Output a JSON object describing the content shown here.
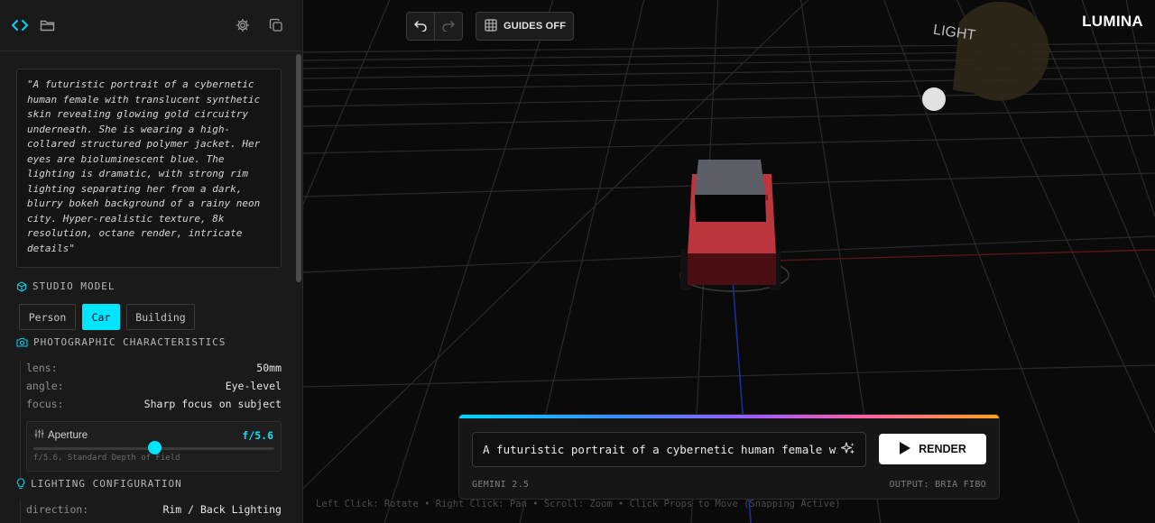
{
  "sidebar": {
    "prompt_text": "\"A futuristic portrait of a cybernetic human female with translucent synthetic skin revealing glowing gold circuitry underneath. She is wearing a high-collared structured polymer jacket. Her eyes are bioluminescent blue. The lighting is dramatic, with strong rim lighting separating her from a dark, blurry bokeh background of a rainy neon city. Hyper-realistic texture, 8k resolution, octane render, intricate details\"",
    "studio_model": {
      "title": "STUDIO MODEL",
      "options": [
        "Person",
        "Car",
        "Building"
      ],
      "selected": "Car"
    },
    "photographic": {
      "title": "PHOTOGRAPHIC CHARACTERISTICS",
      "rows": [
        {
          "key": "lens:",
          "value": "50mm"
        },
        {
          "key": "angle:",
          "value": "Eye-level"
        },
        {
          "key": "focus:",
          "value": "Sharp focus on subject"
        }
      ],
      "aperture": {
        "label": "Aperture",
        "value": "f/5.6",
        "description": "f/5.6, Standard Depth of Field",
        "level": 0.5
      }
    },
    "lighting": {
      "title": "LIGHTING CONFIGURATION",
      "rows": [
        {
          "key": "direction:",
          "value": "Rim / Back Lighting"
        }
      ]
    }
  },
  "toolbar": {
    "guides_label": "GUIDES OFF"
  },
  "brand": "LUMINA",
  "scene": {
    "light_label": "LIGHT",
    "hint": "Left Click: Rotate • Right Click: Pan • Scroll: Zoom • Click Props to Move (Snapping Active)"
  },
  "render_bar": {
    "prompt_value": "A futuristic portrait of a cybernetic human female with translucent synthetic skin",
    "render_label": "RENDER",
    "model_label": "GEMINI 2.5",
    "output_label": "OUTPUT: BRIA FIBO"
  },
  "colors": {
    "accent": "#00e5ff",
    "car_body": "#b8343a",
    "car_roof": "#5c5e66",
    "light_cone": "#3a3018"
  },
  "icons": {
    "code": "code-icon",
    "folder": "folder-icon",
    "settings": "gear-icon",
    "copy": "copy-icon",
    "undo": "undo-icon",
    "redo": "redo-icon",
    "grid": "grid-icon",
    "sparkle": "sparkle-icon",
    "play": "play-icon"
  }
}
